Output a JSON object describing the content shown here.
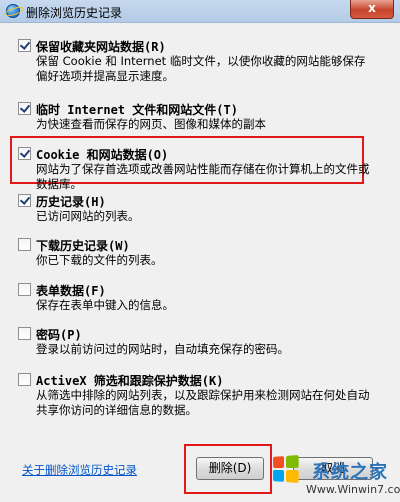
{
  "window": {
    "title": "删除浏览历史记录",
    "close_label": "x"
  },
  "options": [
    {
      "label": "保留收藏夹网站数据(R)",
      "desc": "保留 Cookie 和 Internet 临时文件，以使你收藏的网站能够保存偏好选项并提高显示速度。",
      "checked": true
    },
    {
      "label": "临时 Internet 文件和网站文件(T)",
      "desc": "为快速查看而保存的网页、图像和媒体的副本",
      "checked": true
    },
    {
      "label": "Cookie 和网站数据(O)",
      "desc": "网站为了保存首选项或改善网站性能而存储在你计算机上的文件或数据库。",
      "checked": true
    },
    {
      "label": "历史记录(H)",
      "desc": "已访问网站的列表。",
      "checked": true
    },
    {
      "label": "下载历史记录(W)",
      "desc": "你已下载的文件的列表。",
      "checked": false
    },
    {
      "label": "表单数据(F)",
      "desc": "保存在表单中键入的信息。",
      "checked": false
    },
    {
      "label": "密码(P)",
      "desc": "登录以前访问过的网站时，自动填充保存的密码。",
      "checked": false
    },
    {
      "label": "ActiveX 筛选和跟踪保护数据(K)",
      "desc": "从筛选中排除的网站列表，以及跟踪保护用来检测网站在何处自动共享你访问的详细信息的数据。",
      "checked": false
    }
  ],
  "footer": {
    "about_link": "关于删除浏览历史记录",
    "delete_label": "删除(D)",
    "cancel_label": "取消"
  },
  "watermark": {
    "title": "系统之家",
    "url": "Www.Winwin7.com"
  },
  "colors": {
    "highlight": "#e01818",
    "link": "#0055cc"
  }
}
